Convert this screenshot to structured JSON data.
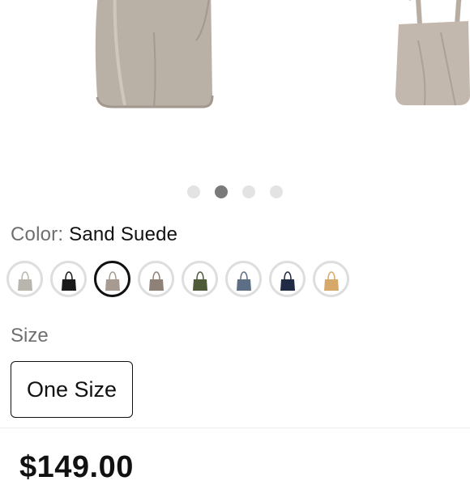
{
  "gallery": {
    "images": [
      "bag-front-image",
      "bag-side-image"
    ],
    "dots_count": 4,
    "active_dot": 2
  },
  "color": {
    "label": "Color:",
    "value": "Sand Suede",
    "swatches": [
      {
        "name": "snake-print",
        "fill": "#b9b6ae"
      },
      {
        "name": "black",
        "fill": "#1a1a1a"
      },
      {
        "name": "sand-suede",
        "fill": "#a79b91"
      },
      {
        "name": "taupe",
        "fill": "#8f8078"
      },
      {
        "name": "olive",
        "fill": "#4f5a38"
      },
      {
        "name": "slate-blue",
        "fill": "#5d6f84"
      },
      {
        "name": "navy",
        "fill": "#1f2a44"
      },
      {
        "name": "tan",
        "fill": "#d6a86a"
      }
    ],
    "selected_index": 2
  },
  "size": {
    "label": "Size",
    "option": "One Size"
  },
  "price": "$149.00"
}
